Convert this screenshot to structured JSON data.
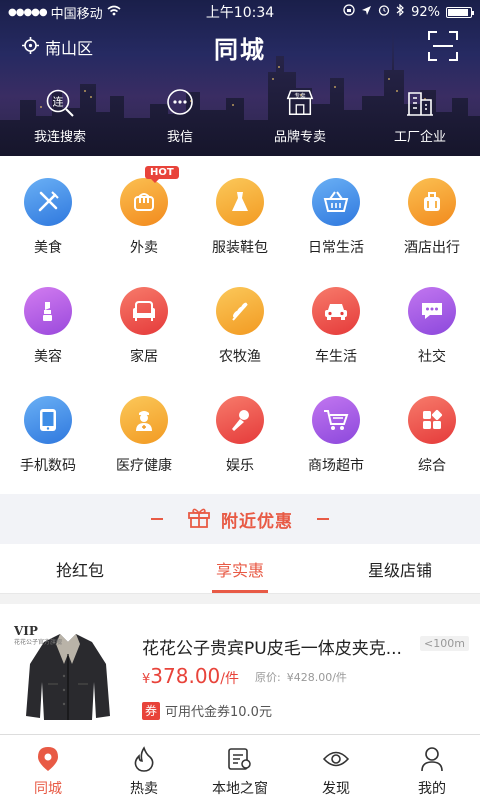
{
  "status_bar": {
    "carrier": "中国移动",
    "time": "上午10:34",
    "battery": "92%",
    "battery_level": 0.92
  },
  "header": {
    "location": "南山区",
    "title": "同城"
  },
  "quick_nav": [
    {
      "label": "我连搜索",
      "icon": "search-lian-icon"
    },
    {
      "label": "我信",
      "icon": "chat-bubble-icon"
    },
    {
      "label": "品牌专卖",
      "icon": "store-icon"
    },
    {
      "label": "工厂企业",
      "icon": "building-icon"
    }
  ],
  "quick_icon_text": {
    "search": "连",
    "store": "专卖"
  },
  "categories": [
    {
      "label": "美食",
      "icon": "fork-knife-icon",
      "color": "#4a8fe8"
    },
    {
      "label": "外卖",
      "icon": "takeout-icon",
      "color": "#f59a23",
      "badge": "HOT"
    },
    {
      "label": "服装鞋包",
      "icon": "dress-icon",
      "color": "#f4a832"
    },
    {
      "label": "日常生活",
      "icon": "basket-icon",
      "color": "#3e8de6"
    },
    {
      "label": "酒店出行",
      "icon": "luggage-icon",
      "color": "#f5a122"
    },
    {
      "label": "美容",
      "icon": "lipstick-icon",
      "color": "#b45ee0"
    },
    {
      "label": "家居",
      "icon": "sofa-icon",
      "color": "#ee4b4b"
    },
    {
      "label": "农牧渔",
      "icon": "wheat-icon",
      "color": "#f4a832"
    },
    {
      "label": "车生活",
      "icon": "car-icon",
      "color": "#ee4b4b"
    },
    {
      "label": "社交",
      "icon": "chat-icon",
      "color": "#a25be0"
    },
    {
      "label": "手机数码",
      "icon": "phone-icon",
      "color": "#3e8de6"
    },
    {
      "label": "医疗健康",
      "icon": "doctor-icon",
      "color": "#f4a832"
    },
    {
      "label": "娱乐",
      "icon": "microphone-icon",
      "color": "#ee4b4b"
    },
    {
      "label": "商场超市",
      "icon": "cart-icon",
      "color": "#a25be0"
    },
    {
      "label": "综合",
      "icon": "grid-icon",
      "color": "#ee4b4b"
    }
  ],
  "nearby": {
    "title": "附近优惠"
  },
  "tabs": [
    {
      "label": "抢红包"
    },
    {
      "label": "享实惠",
      "active": true
    },
    {
      "label": "星级店铺"
    }
  ],
  "product": {
    "brand": "VIP",
    "brand_sub": "花花公子官方旗舰",
    "title": "花花公子贵宾PU皮毛一体皮夹克...",
    "distance": "<100m",
    "price_symbol": "¥",
    "price": "378.00",
    "unit": "/件",
    "original_label": "原价:",
    "original_price": "¥428.00/件",
    "coupon_badge": "券",
    "coupon_text": "可用代金券10.0元"
  },
  "bottom_nav": [
    {
      "label": "同城",
      "icon": "location-pin-icon",
      "active": true
    },
    {
      "label": "热卖",
      "icon": "flame-icon"
    },
    {
      "label": "本地之窗",
      "icon": "news-icon"
    },
    {
      "label": "发现",
      "icon": "eye-icon"
    },
    {
      "label": "我的",
      "icon": "person-icon"
    }
  ],
  "colors": {
    "accent": "#e85a45",
    "header_bg": "#262a62"
  }
}
